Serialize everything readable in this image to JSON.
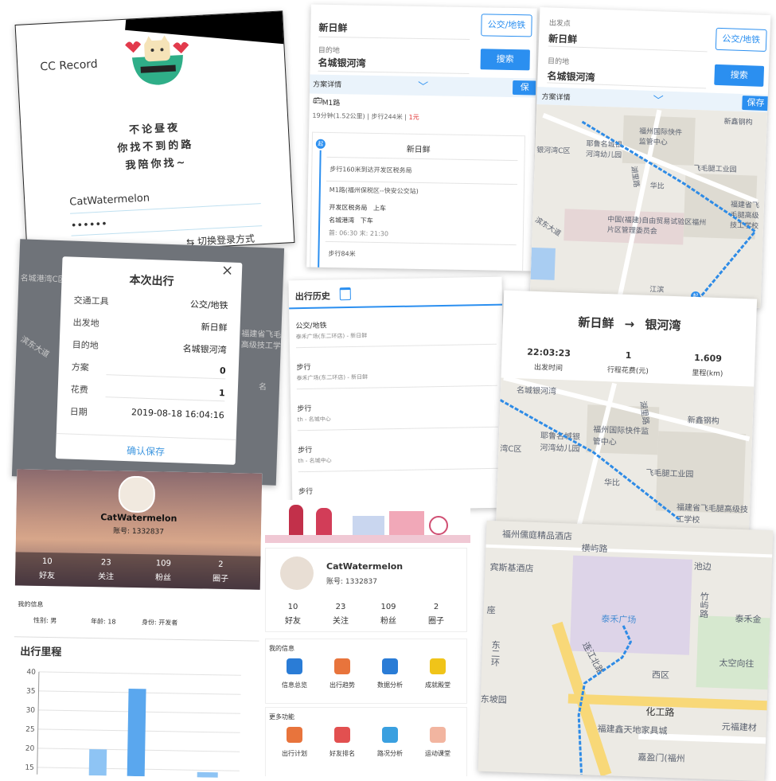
{
  "login": {
    "app_title": "CC Record",
    "slogan_line1": "不论昼夜",
    "slogan_line2": "你找不到的路",
    "slogan_line3": "我陪你找~",
    "username": "CatWatermelon",
    "password_mask": "••••••",
    "switch_label": "切换登录方式"
  },
  "route_search": {
    "from_value": "新日鲜",
    "to_label": "目的地",
    "to_value": "名城银河湾",
    "mode_button": "公交/地铁",
    "search_button": "搜索",
    "plan_details": "方案详情",
    "save_button": "保",
    "route_name": "M1路",
    "route_summary": "19分钟(1.52公里) | 步行244米 |",
    "route_fare": "1元",
    "start_name": "新日鲜",
    "step_walk1": "步行160米到达开发区税务局",
    "step_bus": "M1路(福州保税区--快安公交站)",
    "board_stop": "开发区税务局",
    "board_action": "上车",
    "alight_stop": "名城港湾",
    "alight_action": "下车",
    "hours": "首: 06:30 末: 21:30",
    "step_walk2": "步行84米",
    "start_badge": "起"
  },
  "route_map": {
    "from_label": "出发点",
    "from_value": "新日鲜",
    "to_label": "目的地",
    "to_value": "名城银河湾",
    "mode_button": "公交/地铁",
    "search_button": "搜索",
    "plan_details": "方案详情",
    "save_button": "保存",
    "places": [
      "新鑫钢构",
      "福州国际快件监管中心",
      "耶鲁名城银河湾幼儿园",
      "华比",
      "飞毛腿工业园",
      "中国(福建)自由贸易试验区福州片区管理委员会",
      "福建省飞毛腿高级技工学校",
      "银河湾C区",
      "滨东大道",
      "湖里路",
      "江滨"
    ],
    "end_badge": "起"
  },
  "trip_dialog": {
    "title": "本次出行",
    "close_icon": "×",
    "rows": [
      {
        "label": "交通工具",
        "value": "公交/地铁"
      },
      {
        "label": "出发地",
        "value": "新日鲜"
      },
      {
        "label": "目的地",
        "value": "名城银河湾"
      },
      {
        "label": "方案",
        "value": "0"
      },
      {
        "label": "花费",
        "value": "1"
      },
      {
        "label": "日期",
        "value": "2019-08-18 16:04:16"
      }
    ],
    "confirm_button": "确认保存",
    "bg_labels": [
      "名城港湾C区",
      "滨东大道",
      "福建省飞毛",
      "高级技工学",
      "名"
    ]
  },
  "history": {
    "title": "出行历史",
    "items": [
      {
        "mode": "公交/地铁",
        "route": "泰禾广场(东二环店) - 新日鲜"
      },
      {
        "mode": "步行",
        "route": "泰禾广场(东二环店) - 新日鲜"
      },
      {
        "mode": "步行",
        "route": "th - 名城中心"
      },
      {
        "mode": "步行",
        "route": "th - 名城中心"
      },
      {
        "mode": "步行",
        "route": ""
      }
    ]
  },
  "trip_summary": {
    "from": "新日鲜",
    "arrow": "→",
    "to": "银河湾",
    "stats": [
      {
        "value": "22:03:23",
        "label": "出发时间"
      },
      {
        "value": "1",
        "label": "行程花费(元)"
      },
      {
        "value": "1.609",
        "label": "里程(km)"
      }
    ],
    "places": [
      "名城银河湾",
      "湖里路",
      "新鑫钢构",
      "福州国际快件监管中心",
      "耶鲁名城银河湾幼儿园",
      "湾C区",
      "飞毛腿工业园",
      "华比",
      "福建省飞毛腿高级技工学校"
    ]
  },
  "profile_header": {
    "name": "CatWatermelon",
    "account": "账号: 1332837",
    "stats": [
      {
        "value": "10",
        "label": "好友"
      },
      {
        "value": "23",
        "label": "关注"
      },
      {
        "value": "109",
        "label": "粉丝"
      },
      {
        "value": "2",
        "label": "圈子"
      }
    ],
    "info_title": "我的信息",
    "gender": "性别: 男",
    "age": "年龄: 18",
    "identity": "身份: 开发者"
  },
  "mileage_chart": {
    "title": "出行里程",
    "yticks": [
      "40",
      "35",
      "30",
      "25",
      "20",
      "15"
    ]
  },
  "chart_data": {
    "type": "bar",
    "title": "出行里程",
    "ylim": [
      15,
      40
    ],
    "grid": true,
    "values": [
      20,
      36,
      14.5
    ]
  },
  "profile_menu": {
    "name": "CatWatermelon",
    "account": "账号: 1332837",
    "stats": [
      {
        "value": "10",
        "label": "好友"
      },
      {
        "value": "23",
        "label": "关注"
      },
      {
        "value": "109",
        "label": "粉丝"
      },
      {
        "value": "2",
        "label": "圈子"
      }
    ],
    "my_info_title": "我的信息",
    "my_info_items": [
      {
        "icon": "pie-chart-icon",
        "label": "信息总览"
      },
      {
        "icon": "bar-trend-icon",
        "label": "出行趋势"
      },
      {
        "icon": "presentation-icon",
        "label": "数据分析"
      },
      {
        "icon": "medal-icon",
        "label": "成就殿堂"
      }
    ],
    "more_title": "更多功能",
    "more_items": [
      {
        "icon": "clock-doc-icon",
        "label": "出行计划"
      },
      {
        "icon": "podium-icon",
        "label": "好友排名"
      },
      {
        "icon": "map-icon",
        "label": "路况分析"
      },
      {
        "icon": "chart-doc-icon",
        "label": "运动课堂"
      }
    ]
  },
  "walk_map": {
    "places": [
      "福州儒庭精品酒店",
      "横屿路",
      "宾斯基酒店",
      "池边",
      "座",
      "竹屿路",
      "泰禾金",
      "泰禾广场",
      "西区",
      "太空向往",
      "东坡园",
      "化工路",
      "福建鑫天地家具城",
      "元福建材",
      "连江北路",
      "东二环",
      "嘉盈门(福州"
    ]
  },
  "colors": {
    "accent": "#2b8ff0",
    "route": "#2e8be6",
    "dialog_confirm": "#3f97e0"
  }
}
